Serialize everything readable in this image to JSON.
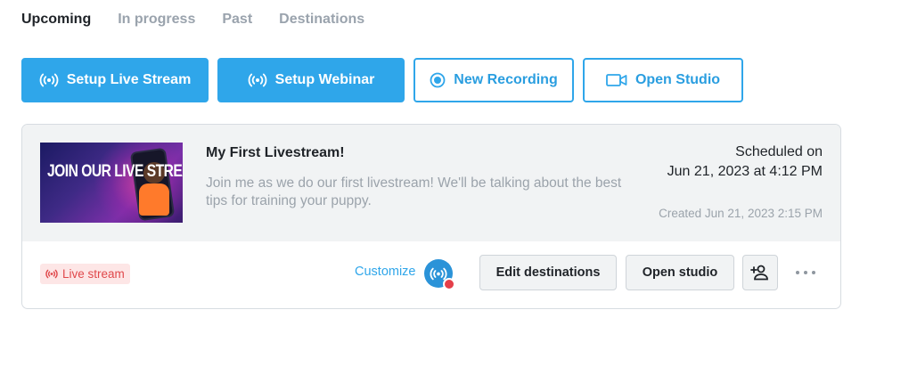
{
  "tabs": [
    {
      "label": "Upcoming",
      "active": true
    },
    {
      "label": "In progress",
      "active": false
    },
    {
      "label": "Past",
      "active": false
    },
    {
      "label": "Destinations",
      "active": false
    }
  ],
  "actions": {
    "setup_live_stream": {
      "label": "Setup Live Stream",
      "icon": "broadcast-icon"
    },
    "setup_webinar": {
      "label": "Setup Webinar",
      "icon": "broadcast-icon"
    },
    "new_recording": {
      "label": "New Recording",
      "icon": "record-icon"
    },
    "open_studio": {
      "label": "Open Studio",
      "icon": "video-camera-icon"
    }
  },
  "event": {
    "thumbnail_text": "JOIN OUR LIVE STREAM",
    "title": "My First Livestream!",
    "description": "Join me as we do our first livestream! We'll be talking about the best tips for training your puppy.",
    "scheduled_label": "Scheduled on",
    "scheduled_date": "Jun 21, 2023 at 4:12 PM",
    "created": "Created Jun 21, 2023 2:15 PM",
    "type_badge": "Live stream",
    "customize_label": "Customize",
    "edit_destinations_label": "Edit destinations",
    "open_studio_label": "Open studio",
    "add_guest_icon": "add-person-icon",
    "more_icon": "more-horizontal-icon"
  },
  "colors": {
    "accent": "#2fa6ea",
    "badge_bg": "#fde6e6",
    "badge_text": "#e0484b",
    "card_header_bg": "#f1f3f4"
  }
}
